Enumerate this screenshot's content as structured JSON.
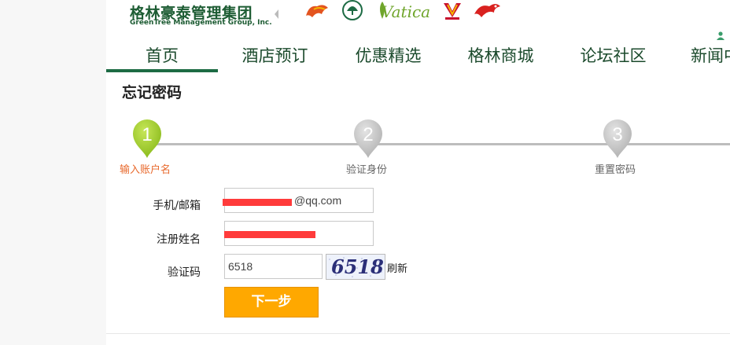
{
  "logo": {
    "name_zh": "格林豪泰管理集团",
    "name_en": "GreenTree  Management Group, Inc."
  },
  "brands": {
    "vatica": "Vatica"
  },
  "nav": {
    "items": [
      "首页",
      "酒店预订",
      "优惠精选",
      "格林商城",
      "论坛社区",
      "新闻中"
    ],
    "active_index": 0
  },
  "page_title": "忘记密码",
  "steps": [
    {
      "number": "1",
      "label": "输入账户名",
      "state": "active"
    },
    {
      "number": "2",
      "label": "验证身份",
      "state": "inactive"
    },
    {
      "number": "3",
      "label": "重置密码",
      "state": "inactive"
    }
  ],
  "form": {
    "account_label": "手机/邮箱",
    "account_value": "@qq.com",
    "name_label": "注册姓名",
    "name_value": "",
    "captcha_label": "验证码",
    "captcha_value": "6518",
    "captcha_image_text": "6518",
    "refresh_label": "刷新",
    "next_label": "下一步"
  },
  "colors": {
    "brand_green": "#1d5c33",
    "active_step": "#9ccc2c",
    "inactive_step": "#c4c4c4",
    "active_step_label": "#e8692c",
    "button": "#ffa800",
    "redaction": "#ff3b3b"
  }
}
